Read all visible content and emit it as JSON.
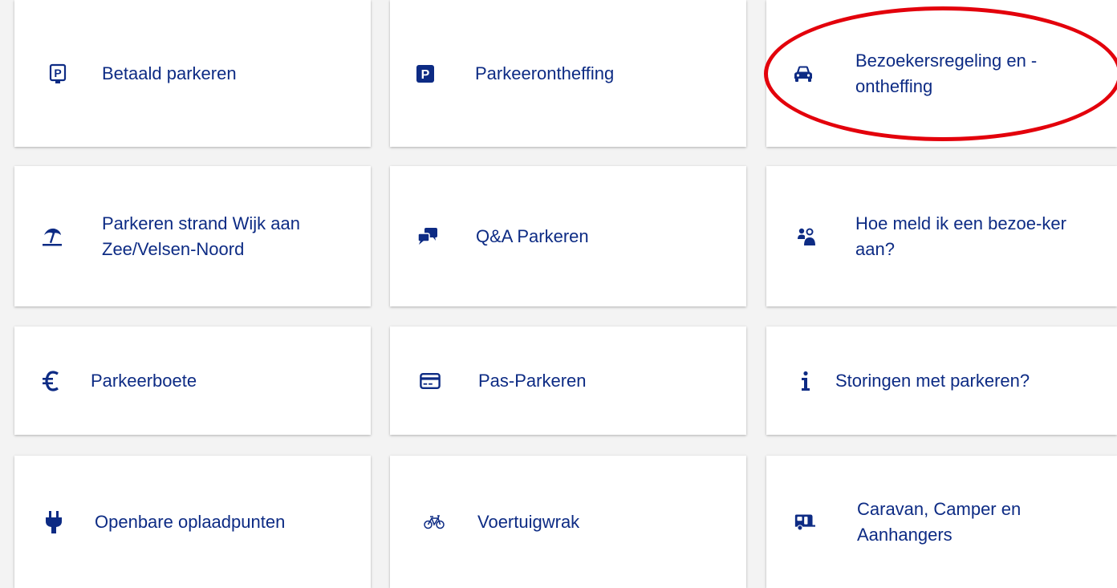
{
  "tiles": [
    {
      "label": "Betaald parkeren",
      "icon": "parking-sign-icon"
    },
    {
      "label": "Parkeerontheffing",
      "icon": "parking-square-icon"
    },
    {
      "label": "Bezoekersregeling en - ontheffing",
      "icon": "car-icon"
    },
    {
      "label": "Parkeren strand Wijk aan Zee/Velsen-Noord",
      "icon": "beach-umbrella-icon"
    },
    {
      "label": "Q&A Parkeren",
      "icon": "chat-bubbles-icon"
    },
    {
      "label": "Hoe meld ik een bezoe-ker aan?",
      "icon": "users-icon"
    },
    {
      "label": "Parkeerboete",
      "icon": "euro-icon"
    },
    {
      "label": "Pas-Parkeren",
      "icon": "credit-card-icon"
    },
    {
      "label": "Storingen met parkeren?",
      "icon": "info-icon"
    },
    {
      "label": "Openbare oplaadpunten",
      "icon": "plug-icon"
    },
    {
      "label": "Voertuigwrak",
      "icon": "bicycle-icon"
    },
    {
      "label": "Caravan, Camper en Aanhangers",
      "icon": "caravan-icon"
    }
  ],
  "colors": {
    "text": "#0d2b84",
    "highlight": "#e3000b",
    "tile_bg": "#ffffff",
    "page_bg": "#f3f3f3"
  }
}
